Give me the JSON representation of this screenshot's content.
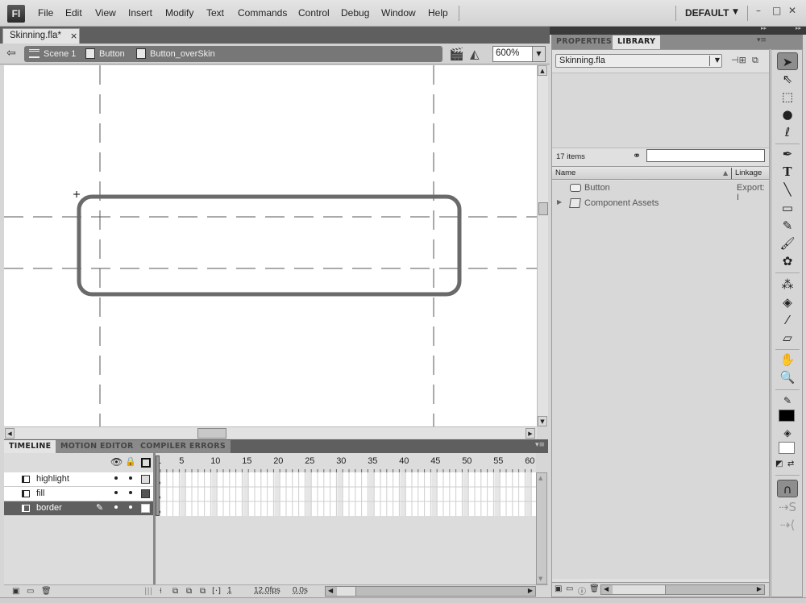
{
  "app": {
    "logo": "Fl",
    "menu": [
      "File",
      "Edit",
      "View",
      "Insert",
      "Modify",
      "Text",
      "Commands",
      "Control",
      "Debug",
      "Window",
      "Help"
    ],
    "workspace": "DEFAULT",
    "window_controls": {
      "minimize": "–",
      "maximize": "□",
      "close": "✕"
    }
  },
  "document": {
    "tab_label": "Skinning.fla*",
    "close_glyph": "×"
  },
  "editbar": {
    "back_glyph": "⇦",
    "breadcrumb": [
      "Scene 1",
      "Button",
      "Button_overSkin"
    ],
    "zoom": "600%"
  },
  "timeline": {
    "tabs": [
      "TIMELINE",
      "MOTION EDITOR",
      "COMPILER ERRORS"
    ],
    "ruler": [
      "1",
      "5",
      "10",
      "15",
      "20",
      "25",
      "30",
      "35",
      "40",
      "45",
      "50",
      "55",
      "60"
    ],
    "layers": [
      {
        "name": "highlight",
        "selected": false,
        "outline_color": "#dddddd"
      },
      {
        "name": "fill",
        "selected": false,
        "outline_color": "#555555"
      },
      {
        "name": "border",
        "selected": true,
        "outline_color": "#ffffff"
      }
    ],
    "footer": {
      "current_frame": "1",
      "frame_rate": "12.0fps",
      "elapsed": "0.0s"
    }
  },
  "library": {
    "tabs": [
      "PROPERTIES",
      "LIBRARY"
    ],
    "active_tab": "LIBRARY",
    "document_select": "Skinning.fla",
    "item_count": "17 items",
    "search_value": "",
    "columns": {
      "name": "Name",
      "linkage": "Linkage"
    },
    "items": [
      {
        "name": "Button",
        "type": "symbol",
        "linkage": "Export: I"
      },
      {
        "name": "Component Assets",
        "type": "folder",
        "linkage": ""
      }
    ]
  },
  "tools": {
    "items": [
      "selection",
      "subselection",
      "free-transform",
      "3d-rotation",
      "lasso",
      "pen",
      "text",
      "line",
      "rectangle",
      "pencil",
      "brush",
      "deco",
      "bone",
      "paint-bucket",
      "eyedropper",
      "eraser",
      "hand",
      "zoom"
    ],
    "stroke_color": "#000000",
    "fill_color": "#ffffff"
  },
  "stage": {
    "shape": "rounded-rectangle",
    "stroke_color": "#6a6a6a"
  }
}
